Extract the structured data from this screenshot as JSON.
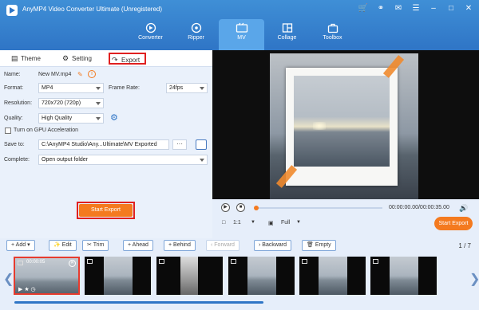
{
  "window": {
    "title": "AnyMP4 Video Converter Ultimate (Unregistered)"
  },
  "nav": {
    "items": [
      {
        "label": "Converter"
      },
      {
        "label": "Ripper"
      },
      {
        "label": "MV"
      },
      {
        "label": "Collage"
      },
      {
        "label": "Toolbox"
      }
    ],
    "active": "MV"
  },
  "tabs": {
    "theme": "Theme",
    "setting": "Setting",
    "export": "Export"
  },
  "export": {
    "name_label": "Name:",
    "name_value": "New MV.mp4",
    "format_label": "Format:",
    "format_value": "MP4",
    "frame_rate_label": "Frame Rate:",
    "frame_rate_value": "24fps",
    "resolution_label": "Resolution:",
    "resolution_value": "720x720 (720p)",
    "quality_label": "Quality:",
    "quality_value": "High Quality",
    "gpu_label": "Turn on GPU Acceleration",
    "save_to_label": "Save to:",
    "save_to_value": "C:\\AnyMP4 Studio\\Any...Ultimate\\MV Exported",
    "complete_label": "Complete:",
    "complete_value": "Open output folder",
    "dots": "···",
    "start_button": "Start Export"
  },
  "player": {
    "time": "00:00:00.00/00:00:35.00",
    "ratio": "1:1",
    "zoom": "Full",
    "start_button": "Start Export"
  },
  "toolbar": {
    "add": "Add",
    "edit": "Edit",
    "trim": "Trim",
    "ahead": "Ahead",
    "behind": "Behind",
    "forward": "Forward",
    "backward": "Backward",
    "empty": "Empty",
    "pager": "1 / 7"
  },
  "clips": [
    {
      "time": "00:00:05"
    }
  ],
  "colors": {
    "accent": "#f47a1f",
    "header": "#2f75c6",
    "highlight": "#e02020"
  }
}
